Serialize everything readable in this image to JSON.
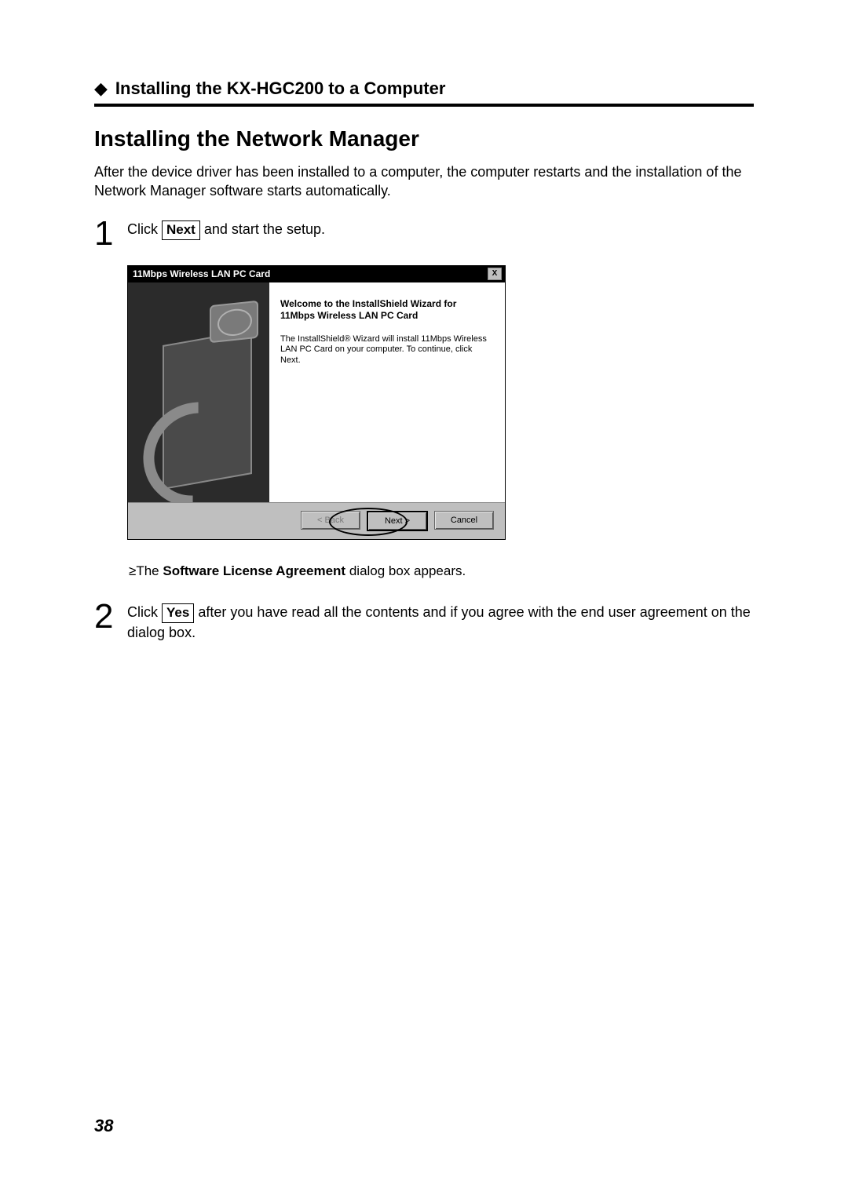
{
  "chapter": {
    "title": "Installing the KX-HGC200 to a Computer"
  },
  "section": {
    "title": "Installing the Network Manager",
    "intro": "After the device driver has been installed to a computer, the computer restarts and the installation of the Network Manager software starts automatically."
  },
  "steps": {
    "s1": {
      "num": "1",
      "pre": "Click ",
      "btn": "Next",
      "post": " and start the setup."
    },
    "s2": {
      "num": "2",
      "pre": "Click ",
      "btn": "Yes",
      "post": " after you have read all the contents and if you agree with the end user agreement on the dialog box."
    }
  },
  "dialog": {
    "title": "11Mbps Wireless LAN PC Card",
    "heading": "Welcome to the InstallShield Wizard for 11Mbps Wireless LAN PC Card",
    "body": "The InstallShield® Wizard will install 11Mbps Wireless LAN PC Card on your computer. To continue, click Next.",
    "buttons": {
      "back": "< Back",
      "next": "Next >",
      "cancel": "Cancel"
    },
    "close": "X"
  },
  "note": {
    "bullet": "≥",
    "pre": "The ",
    "bold": "Software License Agreement",
    "post": " dialog box appears."
  },
  "page_number": "38"
}
